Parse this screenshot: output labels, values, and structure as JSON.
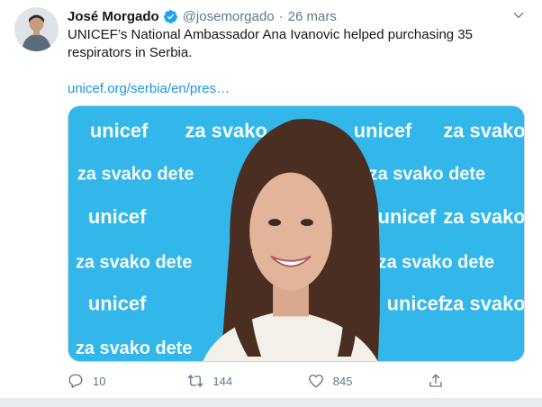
{
  "tweet": {
    "author": {
      "name": "José Morgado",
      "handle": "@josemorgado",
      "verified": true
    },
    "separator": "·",
    "date": "26 mars",
    "text": "UNICEF’s National Ambassador Ana Ivanovic helped purchasing 35 respirators in Serbia.",
    "link": "unicef.org/serbia/en/pres…",
    "media": {
      "backdrop_text_1": "unicef",
      "backdrop_text_2": "za svako",
      "backdrop_text_3": "za svako dete",
      "background_color": "#33b7ea"
    },
    "stats": {
      "replies": "10",
      "retweets": "144",
      "likes": "845"
    }
  },
  "colors": {
    "accent": "#1b95e0",
    "muted": "#657786",
    "text": "#14171a"
  },
  "icons": {
    "verified": "verified-badge-icon",
    "caret": "chevron-down-icon",
    "reply": "reply-icon",
    "retweet": "retweet-icon",
    "like": "heart-icon",
    "share": "share-icon"
  }
}
